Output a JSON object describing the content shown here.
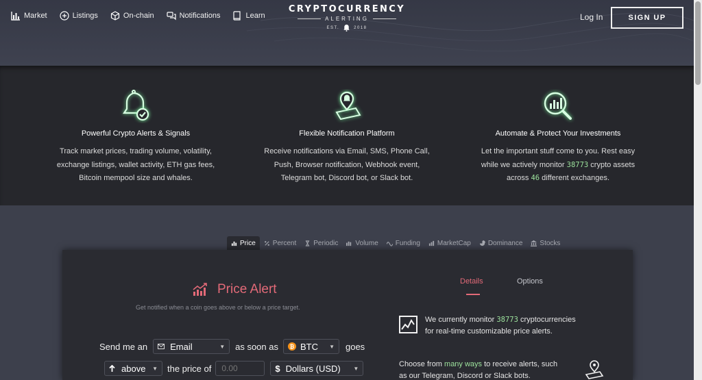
{
  "nav": {
    "items": [
      {
        "label": "Market",
        "icon": "bar-chart-icon"
      },
      {
        "label": "Listings",
        "icon": "plus-circle-icon"
      },
      {
        "label": "On-chain",
        "icon": "cube-icon"
      },
      {
        "label": "Notifications",
        "icon": "chat-bubbles-icon"
      },
      {
        "label": "Learn",
        "icon": "book-icon"
      }
    ],
    "logo_title": "CRYPTOCURRENCY",
    "logo_sub": "ALERTING",
    "logo_est": "EST.",
    "logo_year": "2018",
    "login": "Log In",
    "signup": "SIGN UP"
  },
  "features": [
    {
      "title": "Powerful Crypto Alerts & Signals",
      "lines": [
        "Track market prices, trading volume, volatility,",
        "exchange listings, wallet activity, ETH gas fees,",
        "Bitcoin mempool size and whales."
      ]
    },
    {
      "title": "Flexible Notification Platform",
      "lines": [
        "Receive notifications via Email, SMS, Phone Call,",
        "Push, Browser notification, Webhook event,",
        "Telegram bot, Discord bot, or Slack bot."
      ]
    },
    {
      "title": "Automate & Protect Your Investments",
      "line1": "Let the important stuff come to you. Rest easy",
      "line2_pre": "while we actively monitor ",
      "line2_num": "38773",
      "line2_post": " crypto assets",
      "line3_pre": "across ",
      "line3_num": "46",
      "line3_post": " different exchanges."
    }
  ],
  "tabs": [
    "Price",
    "Percent",
    "Periodic",
    "Volume",
    "Funding",
    "MarketCap",
    "Dominance",
    "Stocks"
  ],
  "alert": {
    "title": "Price Alert",
    "subtitle": "Get notified when a coin goes above or below a price target.",
    "send_me_an": "Send me an",
    "channel": "Email",
    "as_soon_as": "as soon as",
    "coin": "BTC",
    "goes": "goes",
    "direction": "above",
    "the_price_of": "the price of",
    "price_placeholder": "0.00",
    "currency": "Dollars (USD)"
  },
  "side": {
    "details": "Details",
    "options": "Options",
    "monitor_pre": "We currently monitor ",
    "monitor_num": "38773",
    "monitor_post": " cryptocurrencies",
    "monitor_line2": "for real-time customizable price alerts.",
    "choose_pre": "Choose from ",
    "choose_link": "many ways",
    "choose_post": " to receive alerts, such",
    "choose_line2": "as our Telegram, Discord or Slack bots."
  },
  "colors": {
    "accent_red": "#e36a78",
    "highlight_green": "#9de39d",
    "glow_green": "#7cf5a0"
  }
}
